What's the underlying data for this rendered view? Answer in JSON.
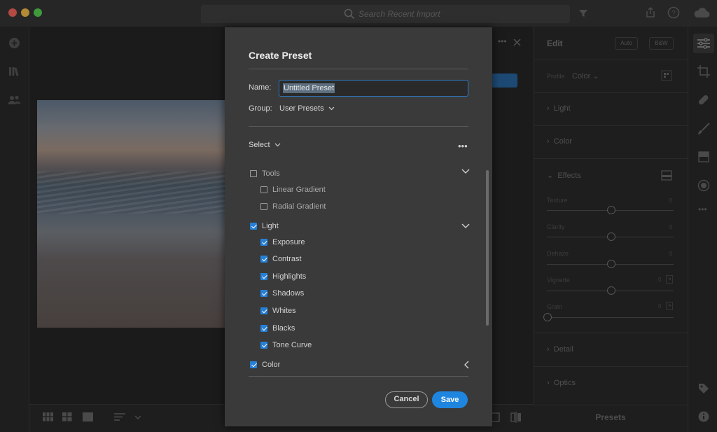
{
  "titlebar": {
    "search_placeholder": "Search Recent Import"
  },
  "colors": {
    "accent": "#2680d8",
    "traffic_close": "#b34a44",
    "traffic_min": "#b38a35",
    "traffic_max": "#3f9a3c"
  },
  "edit_panel": {
    "title": "Edit",
    "auto_label": "Auto",
    "bw_label": "B&W",
    "profile_label": "Profile",
    "profile_value": "Color",
    "sections": {
      "light": "Light",
      "color": "Color",
      "effects": "Effects",
      "detail": "Detail",
      "optics": "Optics"
    },
    "sliders": [
      {
        "label": "Texture",
        "value": "0",
        "position": 0.5
      },
      {
        "label": "Clarity",
        "value": "0",
        "position": 0.5
      },
      {
        "label": "Dehaze",
        "value": "0",
        "position": 0.5
      },
      {
        "label": "Vignette",
        "value": "0",
        "position": 0.5
      },
      {
        "label": "Grain",
        "value": "0",
        "position": 0.0
      }
    ],
    "presets_label": "Presets"
  },
  "modal": {
    "title": "Create Preset",
    "name_label": "Name:",
    "name_value": "Untitled Preset",
    "group_label": "Group:",
    "group_value": "User Presets",
    "select_label": "Select",
    "more_label": "•••",
    "tools": {
      "label": "Tools",
      "checked": false,
      "items": [
        {
          "label": "Linear Gradient",
          "checked": false
        },
        {
          "label": "Radial Gradient",
          "checked": false
        }
      ]
    },
    "light": {
      "label": "Light",
      "checked": true,
      "items": [
        {
          "label": "Exposure",
          "checked": true
        },
        {
          "label": "Contrast",
          "checked": true
        },
        {
          "label": "Highlights",
          "checked": true
        },
        {
          "label": "Shadows",
          "checked": true
        },
        {
          "label": "Whites",
          "checked": true
        },
        {
          "label": "Blacks",
          "checked": true
        },
        {
          "label": "Tone Curve",
          "checked": true
        }
      ]
    },
    "color": {
      "label": "Color",
      "checked": true
    },
    "cancel_label": "Cancel",
    "save_label": "Save"
  }
}
